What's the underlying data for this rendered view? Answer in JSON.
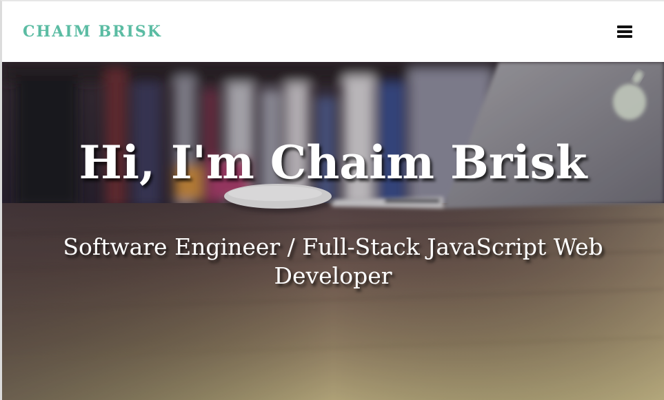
{
  "navbar": {
    "brand": "CHAIM BRISK",
    "menu_icon": "hamburger-menu-icon",
    "brand_color": "#5bbca3"
  },
  "hero": {
    "title": "Hi, I'm Chaim Brisk",
    "subtitle": "Software Engineer / Full-Stack JavaScript Web Developer",
    "background": "blurred-desk-laptop-photo",
    "logo_icon": "apple-logo-icon"
  }
}
